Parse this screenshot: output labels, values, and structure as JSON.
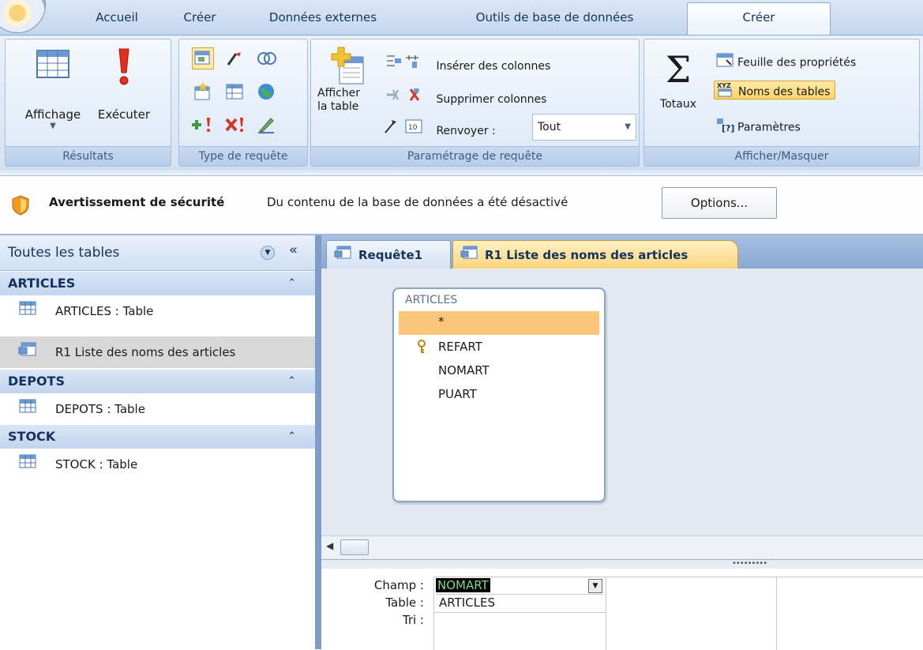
{
  "tabs": [
    "Accueil",
    "Créer",
    "Données externes",
    "Outils de base de données",
    "Créer"
  ],
  "ribbon": {
    "resultats": {
      "label": "Résultats",
      "affichage": "Affichage",
      "executer": "Exécuter"
    },
    "type_requete": {
      "label": "Type de requête"
    },
    "parametrage": {
      "label": "Paramétrage de requête",
      "afficher_table_1": "Afficher",
      "afficher_table_2": "la table",
      "inserer_colonnes": "Insérer des colonnes",
      "supprimer_colonnes": "Supprimer colonnes",
      "renvoyer": "Renvoyer :",
      "renvoyer_value": "Tout"
    },
    "afficher_masquer": {
      "label": "Afficher/Masquer",
      "totaux": "Totaux",
      "feuille_proprietes": "Feuille des propriétés",
      "noms_tables": "Noms des tables",
      "parametres": "Paramètres"
    }
  },
  "security": {
    "title": "Avertissement de sécurité",
    "message": "Du contenu de la base de données a été désactivé",
    "options": "Options..."
  },
  "nav": {
    "header": "Toutes les tables",
    "groups": [
      {
        "name": "ARTICLES",
        "items": [
          "ARTICLES : Table",
          "R1 Liste des noms des articles"
        ]
      },
      {
        "name": "DEPOTS",
        "items": [
          "DEPOTS : Table"
        ]
      },
      {
        "name": "STOCK",
        "items": [
          "STOCK : Table"
        ]
      }
    ]
  },
  "doc_tabs": [
    "Requête1",
    "R1 Liste des noms des articles"
  ],
  "field_list": {
    "title": "ARTICLES",
    "fields": [
      "*",
      "REFART",
      "NOMART",
      "PUART"
    ]
  },
  "grid": {
    "labels": [
      "Champ :",
      "Table :",
      "Tri :"
    ],
    "champ": "NOMART",
    "table": "ARTICLES"
  },
  "colors": {
    "accent": "#fbd46a",
    "ribbon": "#dce8f7",
    "nav_group": "#c2d5ee"
  }
}
